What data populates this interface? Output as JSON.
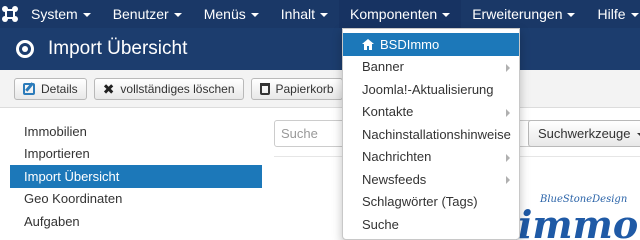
{
  "navbar": {
    "items": [
      {
        "label": "System"
      },
      {
        "label": "Benutzer"
      },
      {
        "label": "Menüs"
      },
      {
        "label": "Inhalt"
      },
      {
        "label": "Komponenten"
      },
      {
        "label": "Erweiterungen"
      },
      {
        "label": "Hilfe"
      }
    ]
  },
  "header": {
    "title": "Import Übersicht"
  },
  "toolbar": {
    "details_label": "Details",
    "delete_label": "vollständiges löschen",
    "trash_label": "Papierkorb"
  },
  "sidebar": {
    "items": [
      {
        "label": "Immobilien"
      },
      {
        "label": "Importieren"
      },
      {
        "label": "Import Übersicht"
      },
      {
        "label": "Geo Koordinaten"
      },
      {
        "label": "Aufgaben"
      }
    ]
  },
  "search": {
    "placeholder": "Suche"
  },
  "search_tools": {
    "label": "Suchwerkzeuge"
  },
  "dropdown": {
    "items": [
      {
        "label": "BSDImmo"
      },
      {
        "label": "Banner"
      },
      {
        "label": "Joomla!-Aktualisierung"
      },
      {
        "label": "Kontakte"
      },
      {
        "label": "Nachinstallationshinweise"
      },
      {
        "label": "Nachrichten"
      },
      {
        "label": "Newsfeeds"
      },
      {
        "label": "Schlagwörter (Tags)"
      },
      {
        "label": "Suche"
      }
    ]
  },
  "watermark": {
    "script_text": "BlueStoneDesign",
    "brand_text": "immo"
  },
  "colors": {
    "navbar": "#1a3867",
    "header": "#1c3d6e",
    "accent": "#1c78b9"
  }
}
